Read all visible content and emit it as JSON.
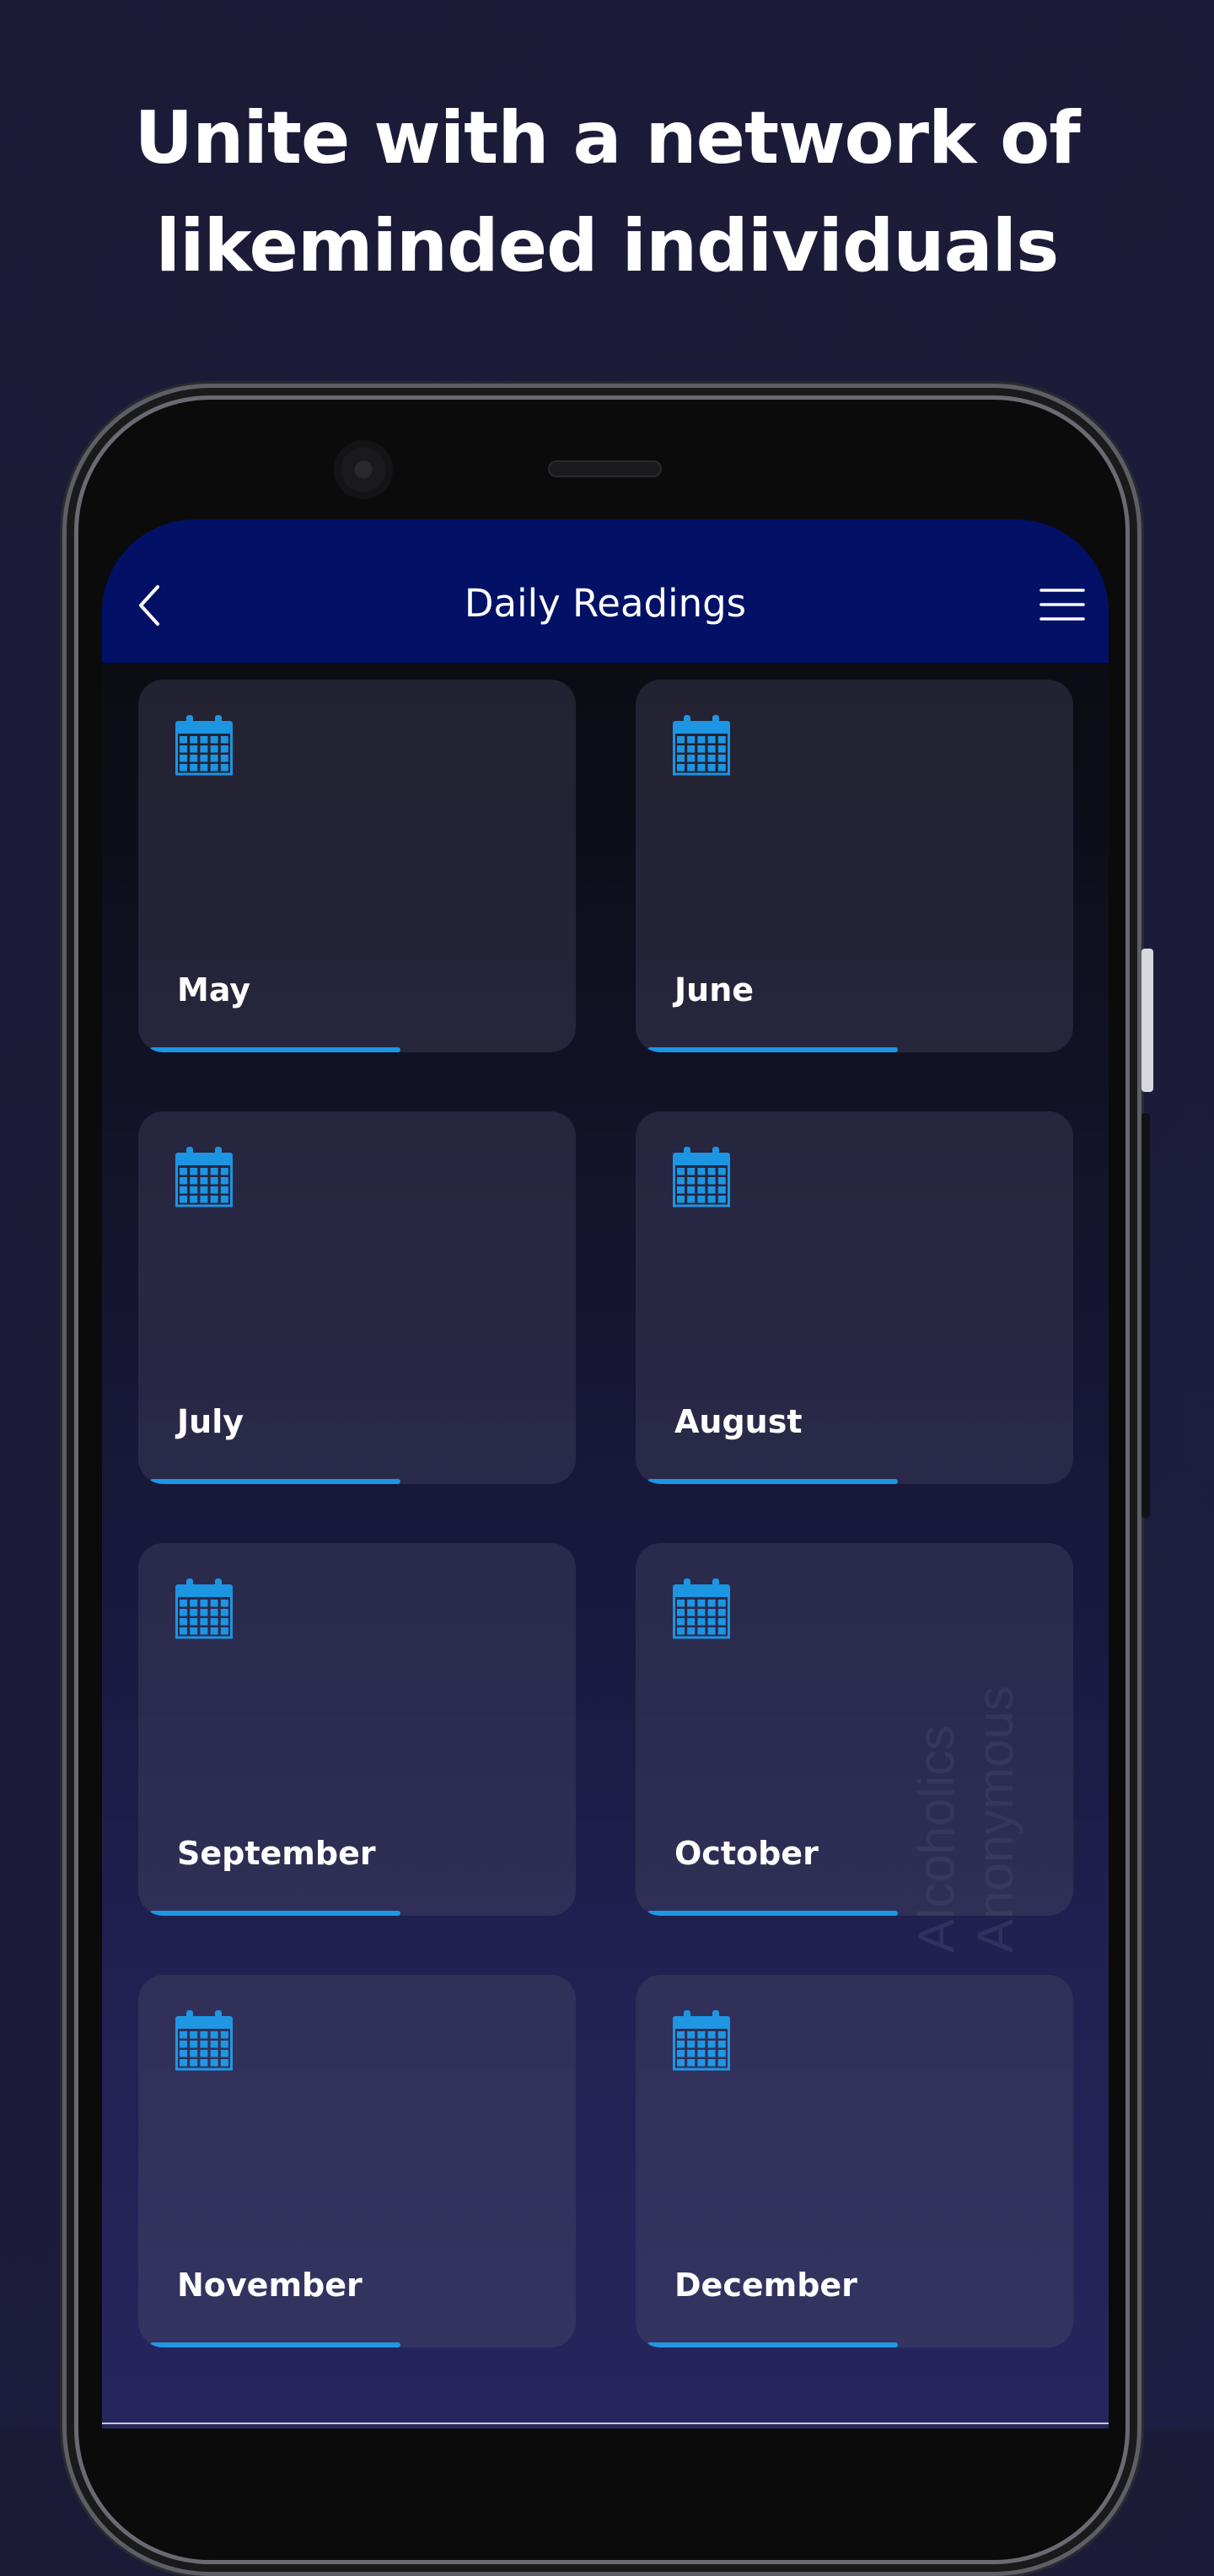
{
  "headline": {
    "line1": "Unite with a network of",
    "line2": "likeminded individuals"
  },
  "appbar": {
    "title": "Daily Readings",
    "back_icon": "chevron-left-icon",
    "menu_icon": "hamburger-menu-icon"
  },
  "months": [
    {
      "label": "May",
      "icon": "calendar-icon"
    },
    {
      "label": "June",
      "icon": "calendar-icon"
    },
    {
      "label": "July",
      "icon": "calendar-icon"
    },
    {
      "label": "August",
      "icon": "calendar-icon"
    },
    {
      "label": "September",
      "icon": "calendar-icon"
    },
    {
      "label": "October",
      "icon": "calendar-icon"
    },
    {
      "label": "November",
      "icon": "calendar-icon"
    },
    {
      "label": "December",
      "icon": "calendar-icon"
    }
  ],
  "watermark": {
    "line1": "Alcoholics",
    "line2": "Anonymous"
  },
  "colors": {
    "appbar": "#021166",
    "accent": "#1c95e3",
    "background": "#1b1b38"
  }
}
